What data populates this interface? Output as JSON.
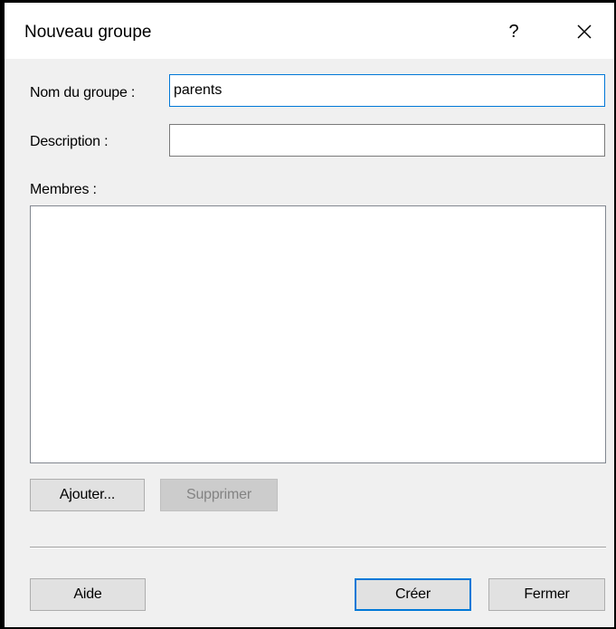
{
  "window": {
    "title": "Nouveau groupe",
    "help_label": "?",
    "close_icon": "close-icon"
  },
  "form": {
    "group_name_label": "Nom du groupe :",
    "group_name_value": "parents",
    "description_label": "Description :",
    "description_value": "",
    "members_label": "Membres :",
    "members_items": []
  },
  "buttons": {
    "add_label": "Ajouter...",
    "remove_label": "Supprimer",
    "help_label": "Aide",
    "create_label": "Créer",
    "close_label": "Fermer"
  },
  "colors": {
    "focus_accent": "#0078d7",
    "dialog_background": "#f0f0f0",
    "titlebar_background": "#ffffff"
  }
}
